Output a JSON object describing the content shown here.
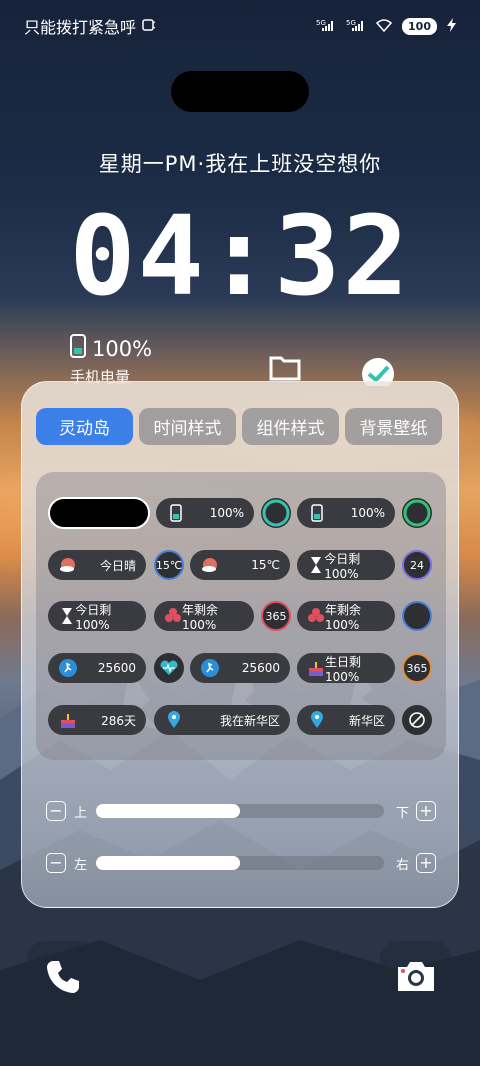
{
  "status": {
    "left_text": "只能拨打紧急呼",
    "sim1": "5G",
    "sim2": "5G",
    "battery": "100"
  },
  "lock": {
    "date_line": "星期一PM·我在上班没空想你",
    "time": "04:32",
    "phone_battery_value": "100%",
    "phone_battery_label": "手机电量"
  },
  "panel": {
    "tabs": [
      {
        "label": "灵动岛",
        "active": true
      },
      {
        "label": "时间样式",
        "active": false
      },
      {
        "label": "组件样式",
        "active": false
      },
      {
        "label": "背景壁纸",
        "active": false
      }
    ],
    "rows": {
      "r1": {
        "pill1": "100%",
        "pill2": "100%"
      },
      "r2": {
        "p1_label": "今日晴",
        "c1": "15℃",
        "p2_value": "15℃",
        "p3_label": "今日剩100%",
        "c2": "24"
      },
      "r3": {
        "p1_label": "今日剩100%",
        "p2_label": "年剩余100%",
        "c1": "365",
        "p3_label": "年剩余100%"
      },
      "r4": {
        "p1_value": "25600",
        "p2_value": "25600",
        "p3_label": "生日剩100%",
        "c1": "365"
      },
      "r5": {
        "p1_value": "286天",
        "p2_label": "我在新华区",
        "p3_label": "新华区"
      }
    },
    "sliders": [
      {
        "minus": "−",
        "left": "上",
        "right": "下",
        "plus": "+",
        "value": 0.5
      },
      {
        "minus": "−",
        "left": "左",
        "right": "右",
        "plus": "+",
        "value": 0.5
      }
    ]
  },
  "icons": {
    "phone": "phone-icon",
    "camera": "camera-icon",
    "hourglass": "hourglass-icon",
    "weather": "sun-cloud-icon",
    "runner": "runner-icon",
    "heart": "heartbeat-icon",
    "location": "location-pin-icon",
    "cake": "cake-icon",
    "flower": "flower-icon",
    "ban": "ban-icon"
  }
}
